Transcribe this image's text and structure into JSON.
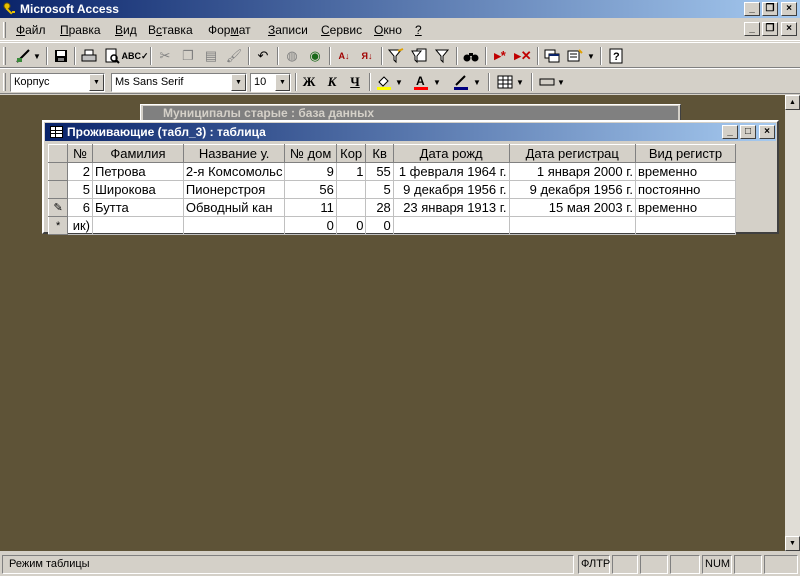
{
  "app": {
    "title": "Microsoft Access"
  },
  "menu": {
    "items": [
      {
        "prefix": "",
        "accel": "Ф",
        "rest": "айл"
      },
      {
        "prefix": "",
        "accel": "П",
        "rest": "равка"
      },
      {
        "prefix": "",
        "accel": "В",
        "rest": "ид"
      },
      {
        "prefix": "В",
        "accel": "с",
        "rest": "тавка"
      },
      {
        "prefix": "Фор",
        "accel": "м",
        "rest": "ат"
      },
      {
        "prefix": "",
        "accel": "З",
        "rest": "аписи"
      },
      {
        "prefix": "",
        "accel": "С",
        "rest": "ервис"
      },
      {
        "prefix": "",
        "accel": "О",
        "rest": "кно"
      },
      {
        "prefix": "",
        "accel": "?",
        "rest": ""
      }
    ]
  },
  "formatting": {
    "object_combo": "Корпус",
    "font_combo": "Ms Sans Serif",
    "size_combo": "10",
    "bold": "Ж",
    "italic": "К",
    "underline": "Ч"
  },
  "background_window": {
    "title": "Муниципалы старые : база данных"
  },
  "table_window": {
    "title": "Проживающие (табл_3) : таблица",
    "columns": [
      "№",
      "Фамилия",
      "Название у.",
      "№ дом",
      "Кор",
      "Кв",
      "Дата рожд",
      "Дата регистрац",
      "Вид регистр"
    ],
    "rows": [
      {
        "selector": "",
        "cells": [
          "2",
          "Петрова",
          "2-я Комсомольс",
          "9",
          "1",
          "55",
          "1 февраля 1964 г.",
          "1 января 2000 г.",
          "временно"
        ]
      },
      {
        "selector": "",
        "cells": [
          "5",
          "Широкова",
          "Пионерстроя",
          "56",
          "",
          "5",
          "9 декабря 1956 г.",
          "9 декабря 1956 г.",
          "постоянно"
        ]
      },
      {
        "selector": "✎",
        "cells": [
          "6",
          "Бутта",
          "Обводный кан",
          "11",
          "",
          "28",
          "23 января 1913 г.",
          "15 мая 2003 г.",
          "временно"
        ]
      },
      {
        "selector": "*",
        "cells": [
          "ик)",
          "",
          "",
          "0",
          "0",
          "0",
          "",
          "",
          ""
        ]
      }
    ]
  },
  "status": {
    "mode": "Режим таблицы",
    "filter": "ФЛТР",
    "num": "NUM"
  }
}
